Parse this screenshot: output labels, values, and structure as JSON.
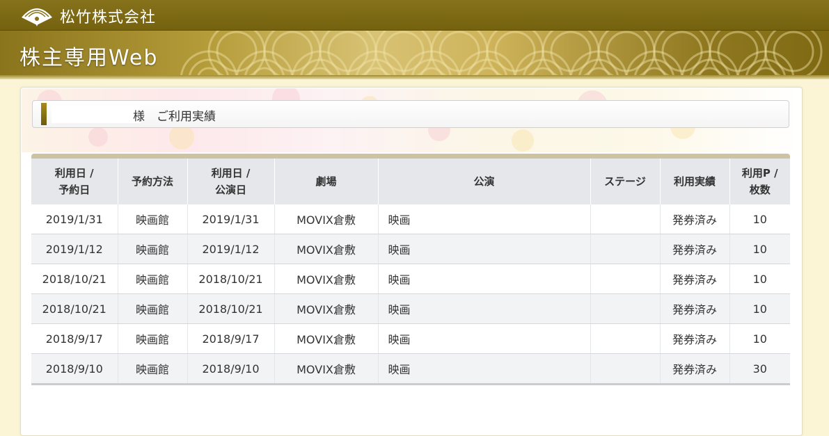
{
  "header": {
    "company_name": "松竹株式会社",
    "site_title": "株主専用Web",
    "logo_icon": "fan-crest-icon"
  },
  "section": {
    "title": "様　ご利用実績"
  },
  "table": {
    "columns": [
      {
        "line1": "利用日 /",
        "line2": "予約日"
      },
      {
        "line1": "予約方法",
        "line2": ""
      },
      {
        "line1": "利用日 /",
        "line2": "公演日"
      },
      {
        "line1": "劇場",
        "line2": ""
      },
      {
        "line1": "公演",
        "line2": ""
      },
      {
        "line1": "ステージ",
        "line2": ""
      },
      {
        "line1": "利用実績",
        "line2": ""
      },
      {
        "line1": "利用P /",
        "line2": "枚数"
      }
    ],
    "rows": [
      {
        "date": "2019/1/31",
        "method": "映画館",
        "show_date": "2019/1/31",
        "theater": "MOVIX倉敷",
        "performance": "映画",
        "stage": "",
        "status": "発券済み",
        "points": "10"
      },
      {
        "date": "2019/1/12",
        "method": "映画館",
        "show_date": "2019/1/12",
        "theater": "MOVIX倉敷",
        "performance": "映画",
        "stage": "",
        "status": "発券済み",
        "points": "10"
      },
      {
        "date": "2018/10/21",
        "method": "映画館",
        "show_date": "2018/10/21",
        "theater": "MOVIX倉敷",
        "performance": "映画",
        "stage": "",
        "status": "発券済み",
        "points": "10"
      },
      {
        "date": "2018/10/21",
        "method": "映画館",
        "show_date": "2018/10/21",
        "theater": "MOVIX倉敷",
        "performance": "映画",
        "stage": "",
        "status": "発券済み",
        "points": "10"
      },
      {
        "date": "2018/9/17",
        "method": "映画館",
        "show_date": "2018/9/17",
        "theater": "MOVIX倉敷",
        "performance": "映画",
        "stage": "",
        "status": "発券済み",
        "points": "10"
      },
      {
        "date": "2018/9/10",
        "method": "映画館",
        "show_date": "2018/9/10",
        "theater": "MOVIX倉敷",
        "performance": "映画",
        "stage": "",
        "status": "発券済み",
        "points": "30"
      }
    ]
  }
}
